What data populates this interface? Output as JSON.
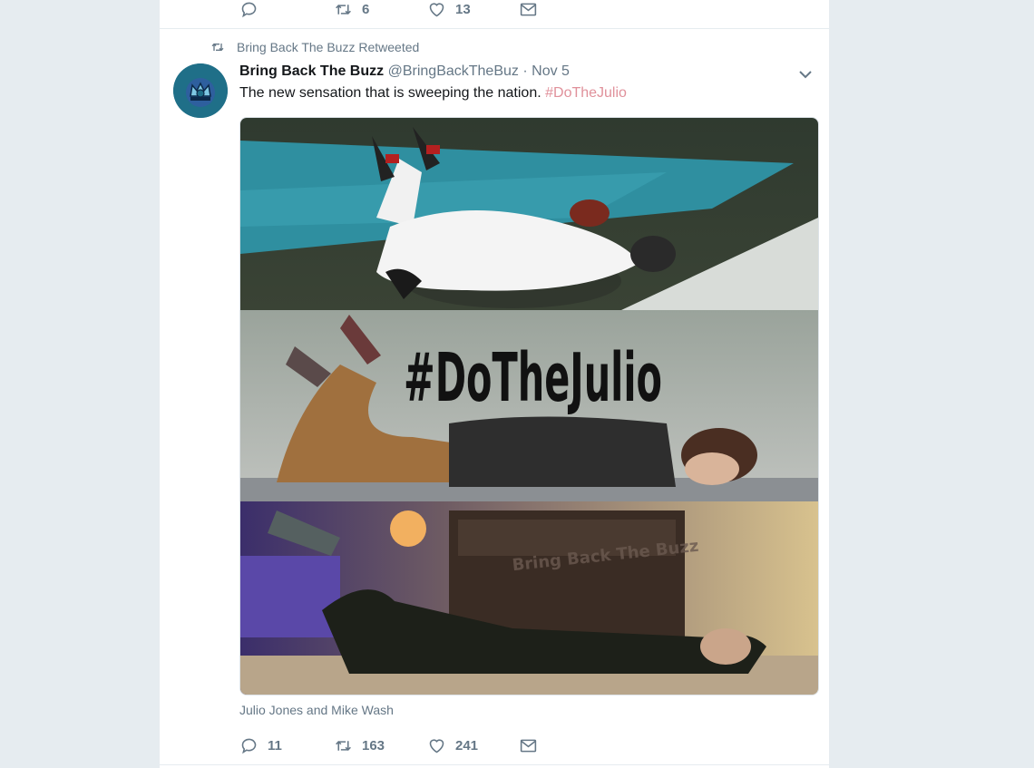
{
  "prev_tweet": {
    "reply_count": "",
    "retweet_count": "6",
    "like_count": "13"
  },
  "tweet": {
    "retweeted_by_label": "Bring Back The Buzz Retweeted",
    "author_name": "Bring Back The Buzz",
    "author_handle": "@BringBackTheBuz",
    "date": "· Nov 5",
    "text": "The new sensation that is sweeping the nation. ",
    "hashtag": "#DoTheJulio",
    "media_overlay_text": "#DoTheJulio",
    "media_watermark": "Bring Back The Buzz",
    "caption": "Julio Jones and Mike Wash",
    "reply_count": "11",
    "retweet_count": "163",
    "like_count": "241"
  },
  "colors": {
    "background": "#e6ecf0",
    "card": "#ffffff",
    "muted": "#657786",
    "hashtag": "#e0919b",
    "avatar": "#1f6f88"
  },
  "icons": [
    "reply-icon",
    "retweet-icon",
    "like-icon",
    "dm-icon",
    "chevron-down-icon",
    "crown-icon"
  ]
}
